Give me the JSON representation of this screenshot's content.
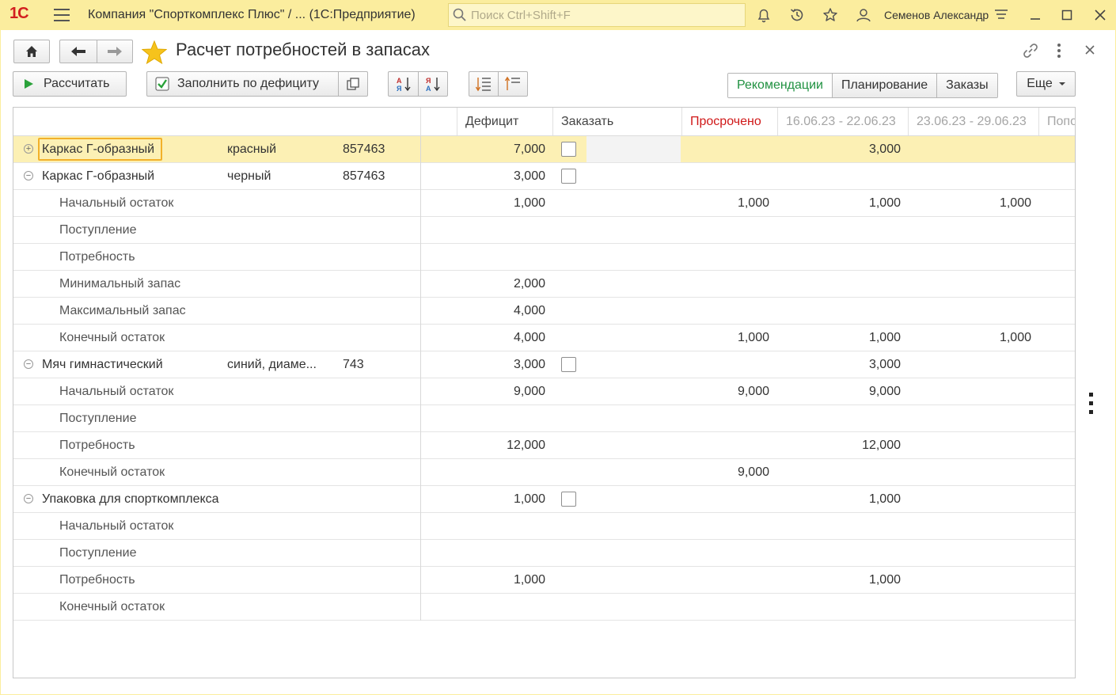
{
  "titlebar": {
    "logo": "1С",
    "title": "Компания \"Спорткомплекс Плюс\" / ...  (1С:Предприятие)",
    "search_placeholder": "Поиск Ctrl+Shift+F",
    "user": "Семенов Александр"
  },
  "form": {
    "title": "Расчет потребностей в запасах",
    "toolbar": {
      "calculate": "Рассчитать",
      "fill_deficit": "Заполнить по дефициту",
      "more": "Еще"
    },
    "views": [
      "Рекомендации",
      "Планирование",
      "Заказы"
    ]
  },
  "grid": {
    "headers": {
      "deficit": "Дефицит",
      "order": "Заказать",
      "overdue": "Просрочено",
      "period1": "16.06.23 - 22.06.23",
      "period2": "23.06.23 - 29.06.23",
      "period3": "Попо"
    },
    "rows": [
      {
        "toggle": "⊕",
        "name": "Каркас Г-образный",
        "char": "красный",
        "code": "857463",
        "deficit": "7,000",
        "check": true,
        "overdue": "",
        "p1": "3,000",
        "p2": "",
        "kind": "group",
        "selected": true
      },
      {
        "toggle": "⊖",
        "name": "Каркас Г-образный",
        "char": "черный",
        "code": "857463",
        "deficit": "3,000",
        "check": true,
        "overdue": "",
        "p1": "",
        "p2": "",
        "kind": "group"
      },
      {
        "name": "Начальный остаток",
        "deficit": "1,000",
        "overdue": "1,000",
        "p1": "1,000",
        "p2": "1,000",
        "kind": "sub"
      },
      {
        "name": "Поступление",
        "deficit": "",
        "overdue": "",
        "p1": "",
        "p2": "",
        "kind": "sub"
      },
      {
        "name": "Потребность",
        "deficit": "",
        "overdue": "",
        "p1": "",
        "p2": "",
        "kind": "sub"
      },
      {
        "name": "Минимальный запас",
        "deficit": "2,000",
        "overdue": "",
        "p1": "",
        "p2": "",
        "kind": "sub"
      },
      {
        "name": "Максимальный запас",
        "deficit": "4,000",
        "overdue": "",
        "p1": "",
        "p2": "",
        "kind": "sub"
      },
      {
        "name": "Конечный остаток",
        "deficit": "4,000",
        "overdue": "1,000",
        "p1": "1,000",
        "p2": "1,000",
        "kind": "sub"
      },
      {
        "toggle": "⊖",
        "name": "Мяч гимнастический",
        "char": "синий, диаме...",
        "code": "743",
        "deficit": "3,000",
        "check": true,
        "overdue": "",
        "p1": "3,000",
        "p2": "",
        "kind": "group"
      },
      {
        "name": "Начальный остаток",
        "deficit": "9,000",
        "overdue": "9,000",
        "p1": "9,000",
        "p2": "",
        "kind": "sub"
      },
      {
        "name": "Поступление",
        "deficit": "",
        "overdue": "",
        "p1": "",
        "p2": "",
        "kind": "sub"
      },
      {
        "name": "Потребность",
        "deficit": "12,000",
        "overdue": "",
        "p1": "12,000",
        "p2": "",
        "kind": "sub"
      },
      {
        "name": "Конечный остаток",
        "deficit": "",
        "overdue": "9,000",
        "p1": "",
        "p2": "",
        "kind": "sub"
      },
      {
        "toggle": "⊖",
        "name": "Упаковка для спорткомплекса",
        "char": "",
        "code": "",
        "deficit": "1,000",
        "check": true,
        "overdue": "",
        "p1": "1,000",
        "p2": "",
        "kind": "group"
      },
      {
        "name": "Начальный остаток",
        "deficit": "",
        "overdue": "",
        "p1": "",
        "p2": "",
        "kind": "sub"
      },
      {
        "name": "Поступление",
        "deficit": "",
        "overdue": "",
        "p1": "",
        "p2": "",
        "kind": "sub"
      },
      {
        "name": "Потребность",
        "deficit": "1,000",
        "overdue": "",
        "p1": "1,000",
        "p2": "",
        "kind": "sub"
      },
      {
        "name": "Конечный остаток",
        "deficit": "",
        "overdue": "",
        "p1": "",
        "p2": "",
        "kind": "sub"
      }
    ]
  }
}
